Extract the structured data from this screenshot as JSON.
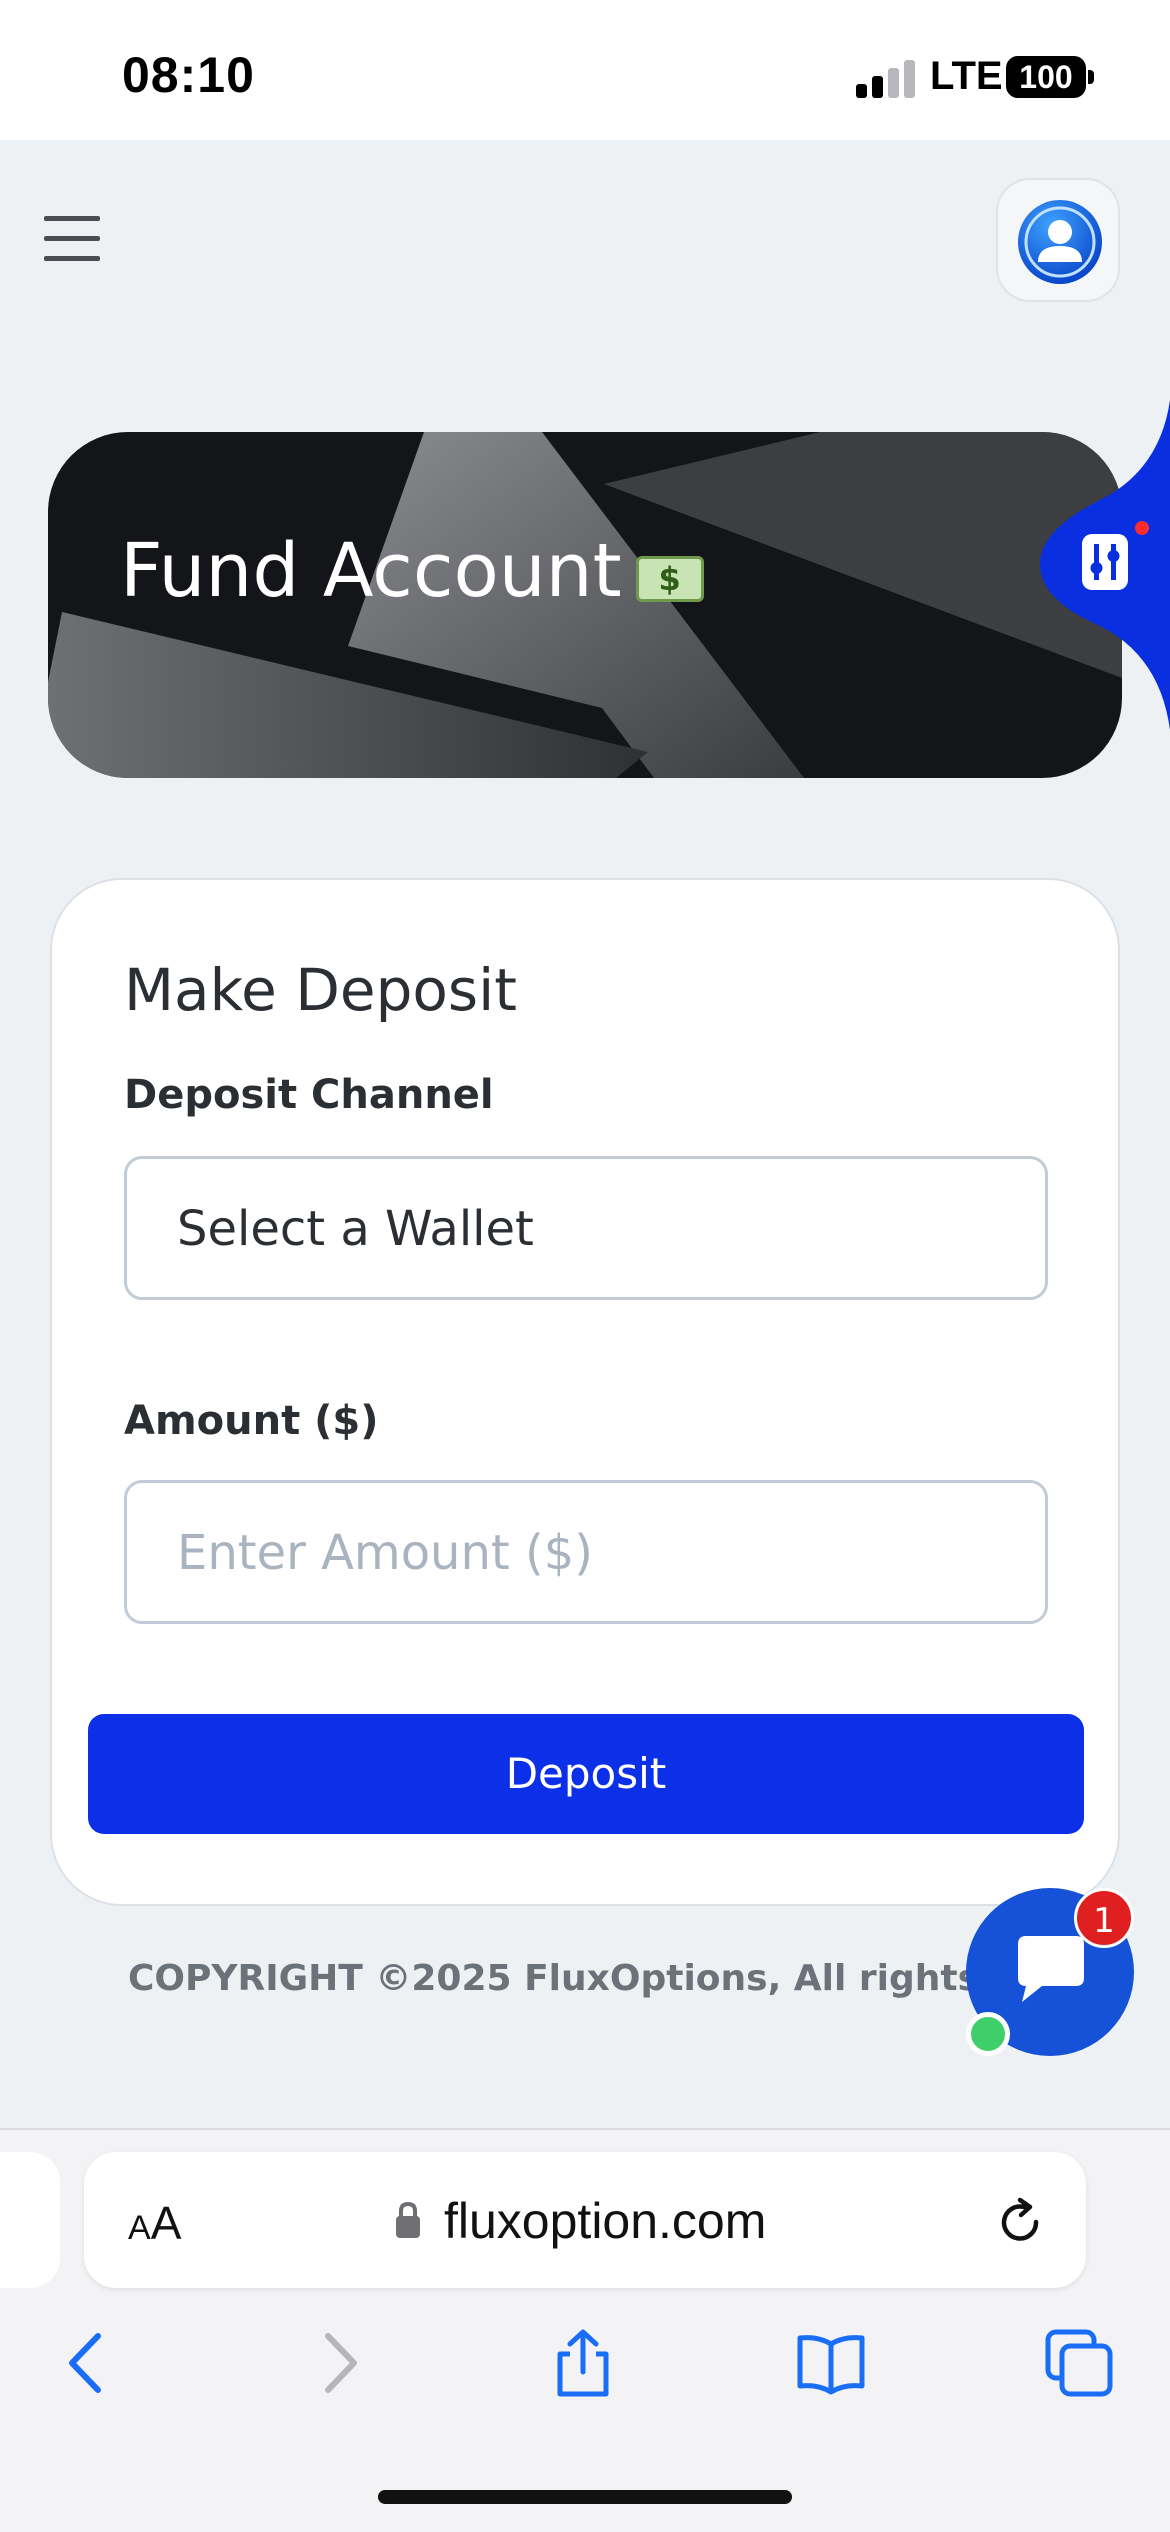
{
  "status_bar": {
    "time": "08:10",
    "network": "LTE",
    "battery": "100"
  },
  "banner": {
    "title": "Fund Account",
    "emoji_label": "$"
  },
  "form": {
    "title": "Make Deposit",
    "channel_label": "Deposit Channel",
    "channel_selected": "Select a Wallet",
    "amount_label": "Amount ($)",
    "amount_placeholder": "Enter Amount ($)",
    "amount_value": "",
    "submit_label": "Deposit"
  },
  "footer": {
    "copyright": "COPYRIGHT ©2025 FluxOptions, All rights Reser"
  },
  "chat": {
    "badge_count": "1"
  },
  "browser": {
    "text_size_small": "A",
    "text_size_big": "A",
    "url": "fluxoption.com"
  },
  "colors": {
    "primary": "#0b30e8",
    "banner_bg": "#141518",
    "page_bg": "#eef1f4",
    "chat": "#1552d8",
    "badge": "#e02020",
    "online": "#3ecf6a"
  },
  "icons": [
    "menu-icon",
    "user-avatar-icon",
    "settings-sliders-icon",
    "money-emoji-icon",
    "chat-icon",
    "lock-icon",
    "reload-icon",
    "back-icon",
    "forward-icon",
    "share-icon",
    "bookmarks-icon",
    "tabs-icon"
  ]
}
